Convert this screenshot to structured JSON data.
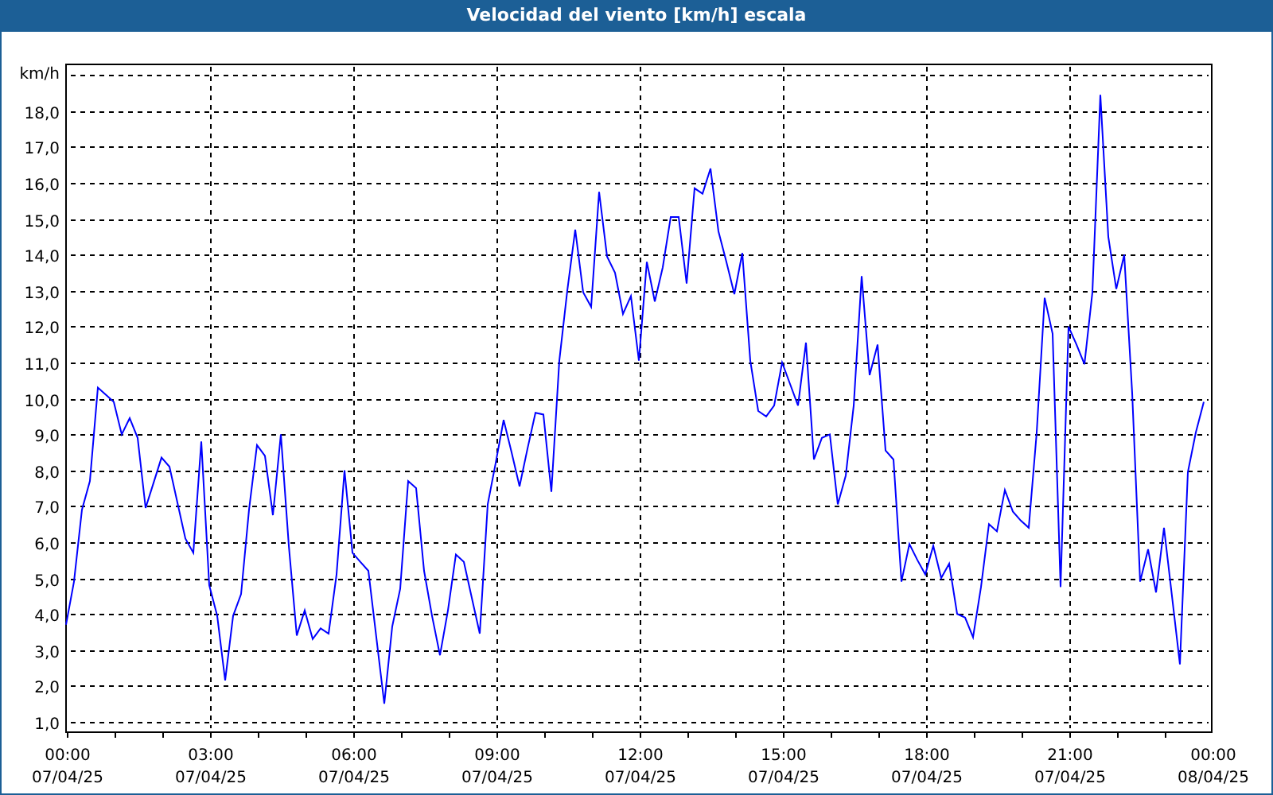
{
  "window": {
    "title": "Velocidad del viento [km/h] escala"
  },
  "chart": {
    "chart_data": {
      "type": "line",
      "ylabel": "km/h",
      "grid": true,
      "categories": [
        "00:00\n07/04/25",
        null,
        null,
        null,
        null,
        null,
        null,
        null,
        null,
        null,
        null,
        null,
        null,
        null,
        null,
        null,
        null,
        null,
        "03:00\n07/04/25",
        null,
        null,
        null,
        null,
        null,
        null,
        null,
        null,
        null,
        null,
        null,
        null,
        null,
        null,
        null,
        null,
        null,
        "06:00\n07/04/25",
        null,
        null,
        null,
        null,
        null,
        null,
        null,
        null,
        null,
        null,
        null,
        null,
        null,
        null,
        null,
        null,
        null,
        "09:00\n07/04/25",
        null,
        null,
        null,
        null,
        null,
        null,
        null,
        null,
        null,
        null,
        null,
        null,
        null,
        null,
        null,
        null,
        null,
        "12:00\n07/04/25",
        null,
        null,
        null,
        null,
        null,
        null,
        null,
        null,
        null,
        null,
        null,
        null,
        null,
        null,
        null,
        null,
        null,
        "15:00\n07/04/25",
        null,
        null,
        null,
        null,
        null,
        null,
        null,
        null,
        null,
        null,
        null,
        null,
        null,
        null,
        null,
        null,
        null,
        "18:00\n07/04/25",
        null,
        null,
        null,
        null,
        null,
        null,
        null,
        null,
        null,
        null,
        null,
        null,
        null,
        null,
        null,
        null,
        null,
        "21:00\n07/04/25",
        null,
        null,
        null,
        null,
        null,
        null,
        null,
        null,
        null,
        null,
        null,
        null,
        null,
        null,
        null,
        null,
        null,
        "00:00\n08/04/25"
      ],
      "series": [
        {
          "color": "#0000ff",
          "values": [
            3.7,
            4.9,
            6.9,
            7.7,
            10.3,
            10.1,
            9.9,
            9.0,
            9.45,
            8.9,
            6.95,
            7.65,
            8.35,
            8.1,
            7.1,
            6.1,
            5.7,
            8.8,
            4.8,
            3.95,
            2.15,
            3.95,
            4.55,
            6.9,
            8.7,
            8.4,
            6.75,
            9.0,
            5.9,
            3.4,
            4.1,
            3.3,
            3.6,
            3.45,
            5.1,
            8.0,
            5.7,
            5.45,
            5.2,
            3.35,
            1.5,
            3.65,
            4.7,
            7.7,
            7.5,
            5.2,
            3.95,
            2.85,
            4.1,
            5.65,
            5.45,
            4.45,
            3.45,
            7.05,
            8.2,
            9.4,
            8.5,
            7.55,
            8.6,
            9.6,
            9.55,
            7.4,
            11.05,
            13.0,
            14.7,
            12.95,
            12.55,
            15.75,
            13.95,
            13.5,
            12.35,
            12.85,
            11.05,
            13.8,
            12.7,
            13.65,
            15.05,
            15.05,
            13.2,
            15.85,
            15.7,
            16.4,
            14.65,
            13.8,
            12.9,
            14.05,
            11.05,
            9.65,
            9.5,
            9.8,
            11.0,
            10.4,
            9.8,
            11.55,
            8.3,
            8.9,
            9.0,
            7.05,
            7.85,
            9.8,
            13.4,
            10.65,
            11.5,
            8.55,
            8.3,
            4.9,
            5.95,
            5.5,
            5.1,
            5.9,
            5.0,
            5.4,
            4.0,
            3.9,
            3.35,
            4.75,
            6.5,
            6.3,
            7.45,
            6.85,
            6.6,
            6.4,
            9.05,
            12.8,
            11.8,
            4.75,
            12.0,
            11.5,
            10.95,
            12.95,
            18.45,
            14.5,
            13.05,
            14.0,
            10.15,
            4.9,
            5.8,
            4.6,
            6.4,
            4.5,
            2.6,
            7.95,
            9.05,
            9.9,
            null
          ]
        }
      ],
      "ylim": [
        0.73,
        19.32
      ],
      "yticks": [
        {
          "value": 1,
          "label": "1,0"
        },
        {
          "value": 2,
          "label": "2,0"
        },
        {
          "value": 3,
          "label": "3,0"
        },
        {
          "value": 4,
          "label": "4,0"
        },
        {
          "value": 5,
          "label": "5,0"
        },
        {
          "value": 6,
          "label": "6,0"
        },
        {
          "value": 7,
          "label": "7,0"
        },
        {
          "value": 8,
          "label": "8,0"
        },
        {
          "value": 9,
          "label": "9,0"
        },
        {
          "value": 10,
          "label": "10,0"
        },
        {
          "value": 11,
          "label": "11,0"
        },
        {
          "value": 12,
          "label": "12,0"
        },
        {
          "value": 13,
          "label": "13,0"
        },
        {
          "value": 14,
          "label": "14,0"
        },
        {
          "value": 15,
          "label": "15,0"
        },
        {
          "value": 16,
          "label": "16,0"
        },
        {
          "value": 17,
          "label": "17,0"
        },
        {
          "value": 18,
          "label": "18,0"
        }
      ]
    }
  }
}
